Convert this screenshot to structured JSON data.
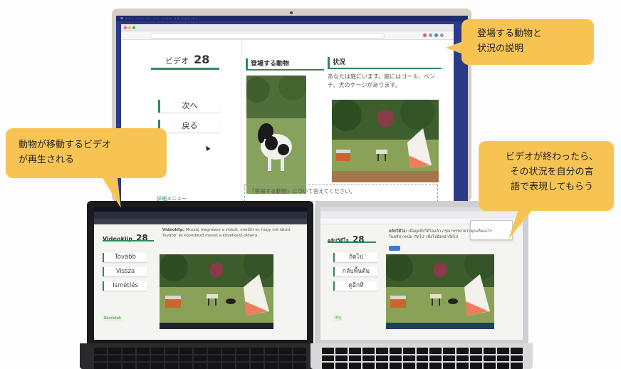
{
  "monitor": {
    "title_label": "ビデオ",
    "title_number": "28",
    "next_button": "次へ",
    "back_button": "戻る",
    "detail_menu": "詳細メニュー",
    "animals_heading": "登場する動物",
    "situation_heading": "状況",
    "situation_text": "あなたは庭にいます。庭にはゴール、ベンチ、犬のケージがあります。",
    "prompt_text": "「登場する動物」について答えてください。"
  },
  "laptop_left": {
    "title_label": "Videoklip",
    "title_number": "28",
    "buttons": [
      "Tovább",
      "Vissza",
      "Ismétlés"
    ],
    "menu_link": "Részletek",
    "desc_title": "Videoklip:",
    "desc_text": "Muszáj megnézze a videót, mielőtt el, hogy mit látott. Tovább' és következő menet a következő oldalra."
  },
  "laptop_right": {
    "title_label": "คลิปวิดีโอ",
    "title_number": "28",
    "buttons": [
      "ถัดไป",
      "กลับพื้นตัม",
      "ดูอีกที"
    ],
    "menu_link": "เมนู",
    "desc_title": "คลิปวิดีโอ:",
    "desc_text": "เมื่อดูคลิปวิดีโอแล้ว กรุณาบรรยายว่าคุณเห็นอะไรในคลิป กดปุ่ม 'ถัดไป' เพื่อไปยังหน้าถัดไป"
  },
  "callouts": {
    "top_right": [
      "登場する動物と",
      "状況の説明"
    ],
    "left": [
      "動物が移動するビデオ",
      "が再生される"
    ],
    "right": [
      "ビデオが終わったら、",
      "その状況を自分の言",
      "語で表現してもらう"
    ]
  },
  "colors": {
    "callout": "#f7c453",
    "accent_green": "#2e8b57",
    "desktop_blue": "#2c3a87"
  }
}
